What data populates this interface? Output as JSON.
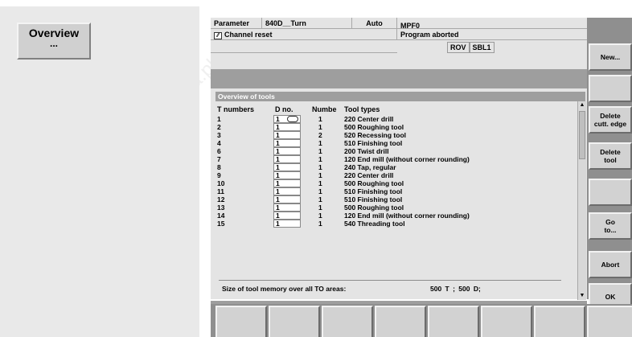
{
  "left": {
    "overview_label": "Overview",
    "overview_sub": "..."
  },
  "header": {
    "parameter": "Parameter",
    "machine": "840D__Turn",
    "mode": "Auto",
    "program": "MPF0",
    "channel_status": "Channel reset",
    "program_status": "Program aborted",
    "flag1": "ROV",
    "flag2": "SBL1"
  },
  "panel": {
    "title": "Overview of tools",
    "columns": {
      "t_numbers": "T numbers",
      "d_no": "D no.",
      "number": "Numbe",
      "tool_types": "Tool types"
    },
    "rows": [
      {
        "t": "1",
        "d": "1",
        "n": "1",
        "type": "220 Center drill"
      },
      {
        "t": "2",
        "d": "1",
        "n": "1",
        "type": "500 Roughing tool"
      },
      {
        "t": "3",
        "d": "1",
        "n": "2",
        "type": "520 Recessing tool"
      },
      {
        "t": "4",
        "d": "1",
        "n": "1",
        "type": "510 Finishing tool"
      },
      {
        "t": "6",
        "d": "1",
        "n": "1",
        "type": "200 Twist drill"
      },
      {
        "t": "7",
        "d": "1",
        "n": "1",
        "type": "120 End mill (without corner rounding)"
      },
      {
        "t": "8",
        "d": "1",
        "n": "1",
        "type": "240 Tap, regular"
      },
      {
        "t": "9",
        "d": "1",
        "n": "1",
        "type": "220 Center drill"
      },
      {
        "t": "10",
        "d": "1",
        "n": "1",
        "type": "500 Roughing tool"
      },
      {
        "t": "11",
        "d": "1",
        "n": "1",
        "type": "510 Finishing tool"
      },
      {
        "t": "12",
        "d": "1",
        "n": "1",
        "type": "510 Finishing tool"
      },
      {
        "t": "13",
        "d": "1",
        "n": "1",
        "type": "500 Roughing tool"
      },
      {
        "t": "14",
        "d": "1",
        "n": "1",
        "type": "120 End mill (without corner rounding)"
      },
      {
        "t": "15",
        "d": "1",
        "n": "1",
        "type": "540 Threading tool"
      }
    ],
    "memory_label": "Size of tool memory over all TO areas:",
    "memory_value": "500 T ;  500 D;"
  },
  "softkeys_right": [
    {
      "label": ""
    },
    {
      "label": "New..."
    },
    {
      "label": ""
    },
    {
      "label": "Delete\ncutt. edge"
    },
    {
      "label": "Delete\ntool"
    },
    {
      "label": ""
    },
    {
      "label": "Go\nto..."
    },
    {
      "label": "Abort"
    },
    {
      "label": "OK"
    }
  ],
  "softkeys_bottom": [
    "",
    "",
    "",
    "",
    "",
    "",
    "",
    ""
  ],
  "watermark": "www.rgbautomatyka.pl"
}
